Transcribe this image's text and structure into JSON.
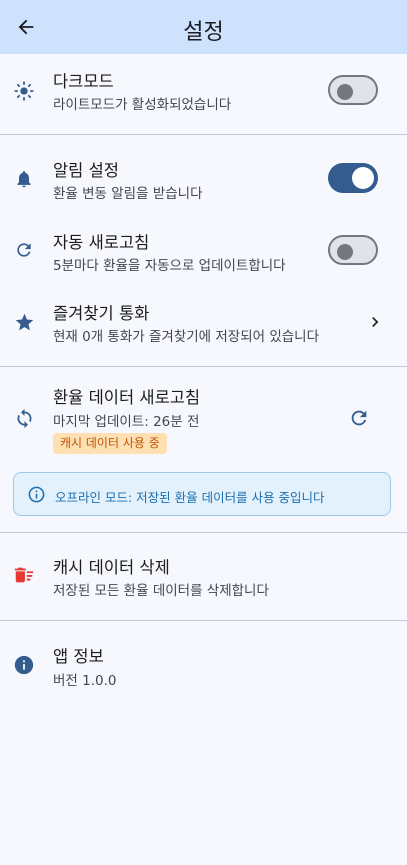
{
  "header": {
    "title": "설정"
  },
  "dark_mode": {
    "title": "다크모드",
    "subtitle": "라이트모드가 활성화되었습니다",
    "enabled": false
  },
  "notifications": {
    "title": "알림 설정",
    "subtitle": "환율 변동 알림을 받습니다",
    "enabled": true
  },
  "auto_refresh": {
    "title": "자동 새로고침",
    "subtitle": "5분마다 환율을 자동으로 업데이트합니다",
    "enabled": false
  },
  "favorites": {
    "title": "즐겨찾기 통화",
    "subtitle": "현재 0개 통화가 즐겨찾기에 저장되어 있습니다"
  },
  "refresh_data": {
    "title": "환율 데이터 새로고침",
    "subtitle": "마지막 업데이트: 26분 전",
    "badge": "캐시 데이터 사용 중"
  },
  "offline_banner": {
    "text": "오프라인 모드: 저장된 환율 데이터를 사용 중입니다"
  },
  "clear_cache": {
    "title": "캐시 데이터 삭제",
    "subtitle": "저장된 모든 환율 데이터를 삭제합니다"
  },
  "app_info": {
    "title": "앱 정보",
    "subtitle": "버전 1.0.0"
  },
  "colors": {
    "appbar": "#cfe2fd",
    "accent": "#345c8f",
    "danger": "#e53935",
    "badge_bg": "#ffe0b2",
    "badge_text": "#c0560b",
    "banner_bg": "#e3f1fc",
    "banner_text": "#1c6fb0"
  },
  "icons": {
    "back": "arrow-back-icon",
    "dark_mode": "sun-icon",
    "notifications": "bell-icon",
    "auto_refresh": "refresh-icon",
    "favorites": "star-icon",
    "favorites_chevron": "chevron-right-icon",
    "refresh_data": "sync-icon",
    "refresh_action": "refresh-icon",
    "offline": "info-outline-icon",
    "clear_cache": "delete-sweep-icon",
    "app_info": "info-icon"
  }
}
